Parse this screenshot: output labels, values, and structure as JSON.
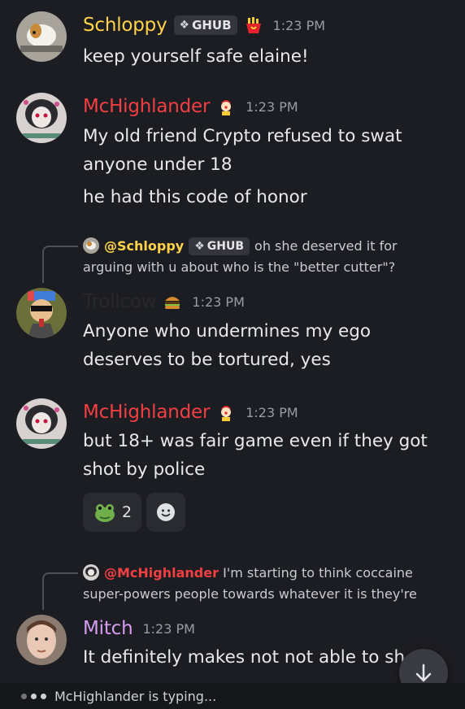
{
  "messages": {
    "m1": {
      "author": "Schloppy",
      "author_color": "#ffd24a",
      "tag": "GHUB",
      "tag_icon": "diamond-icon",
      "time": "1:23 PM",
      "lines": [
        "keep yourself safe elaine!"
      ]
    },
    "m2": {
      "author": "McHighlander",
      "author_color": "#f23f42",
      "time": "1:23 PM",
      "lines": [
        "My old friend Crypto refused to swat",
        "anyone under 18",
        "he had this code of honor"
      ]
    },
    "m3": {
      "reply_author": "@Schloppy",
      "reply_tag": "GHUB",
      "reply_text": "oh she deserved it for arguing with u about who is the \"better cutter\"?",
      "author": "Trollcow",
      "author_color": "#27282c",
      "time": "1:23 PM",
      "lines": [
        "Anyone who undermines my ego",
        "deserves to be tortured, yes"
      ]
    },
    "m4": {
      "author": "McHighlander",
      "author_color": "#f23f42",
      "time": "1:23 PM",
      "lines": [
        "but 18+ was fair game even if they got",
        "shot by police"
      ],
      "reaction_count": "2"
    },
    "m5": {
      "reply_author": "@McHighlander",
      "reply_author_color": "#f23f42",
      "reply_text": "I'm starting to think coccaine super-powers people towards whatever it is they're",
      "author": "Mitch",
      "author_color": "#d59cf0",
      "time": "1:23 PM",
      "lines": [
        "It definitely makes not not able to sh"
      ]
    }
  },
  "typing": {
    "text": "McHighlander is typing..."
  }
}
